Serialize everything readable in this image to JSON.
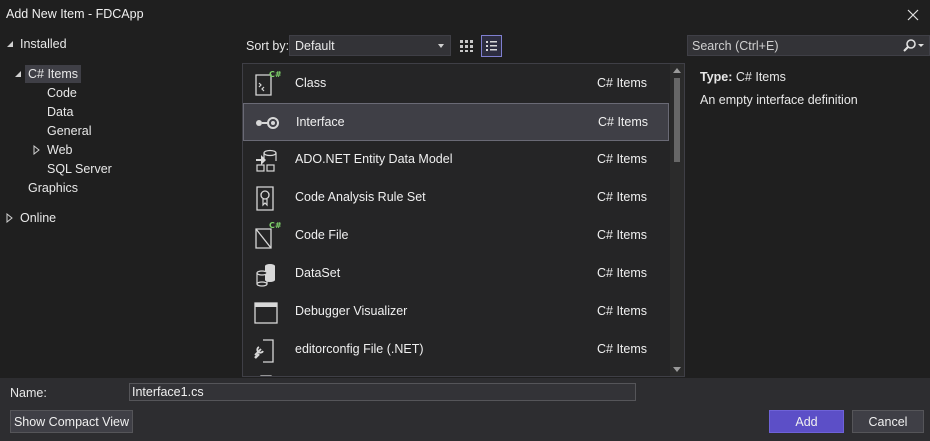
{
  "window": {
    "title": "Add New Item - FDCApp"
  },
  "tree": {
    "installed": "Installed",
    "csharp_items": "C# Items",
    "code": "Code",
    "data": "Data",
    "general": "General",
    "web": "Web",
    "sql_server": "SQL Server",
    "graphics": "Graphics",
    "online": "Online"
  },
  "toolbar": {
    "sort_label": "Sort by:",
    "sort_value": "Default",
    "search_placeholder": "Search (Ctrl+E)"
  },
  "templates": [
    {
      "name": "Class",
      "category": "C# Items",
      "icon": "class-icon"
    },
    {
      "name": "Interface",
      "category": "C# Items",
      "icon": "interface-icon"
    },
    {
      "name": "ADO.NET Entity Data Model",
      "category": "C# Items",
      "icon": "entity-model-icon"
    },
    {
      "name": "Code Analysis Rule Set",
      "category": "C# Items",
      "icon": "rule-set-icon"
    },
    {
      "name": "Code File",
      "category": "C# Items",
      "icon": "code-file-icon"
    },
    {
      "name": "DataSet",
      "category": "C# Items",
      "icon": "dataset-icon"
    },
    {
      "name": "Debugger Visualizer",
      "category": "C# Items",
      "icon": "debugger-visualizer-icon"
    },
    {
      "name": "editorconfig File (.NET)",
      "category": "C# Items",
      "icon": "editorconfig-icon"
    }
  ],
  "selected_template": "Interface",
  "details": {
    "type_label": "Type:",
    "type_value": "C# Items",
    "description": "An empty interface definition"
  },
  "footer": {
    "name_label": "Name:",
    "name_value": "Interface1.cs",
    "compact_view_label": "Show Compact View",
    "add_label": "Add",
    "cancel_label": "Cancel"
  },
  "colors": {
    "background": "#1f1f1f",
    "accent": "#5c4fc7",
    "csharp_badge": "#7fd36b"
  }
}
